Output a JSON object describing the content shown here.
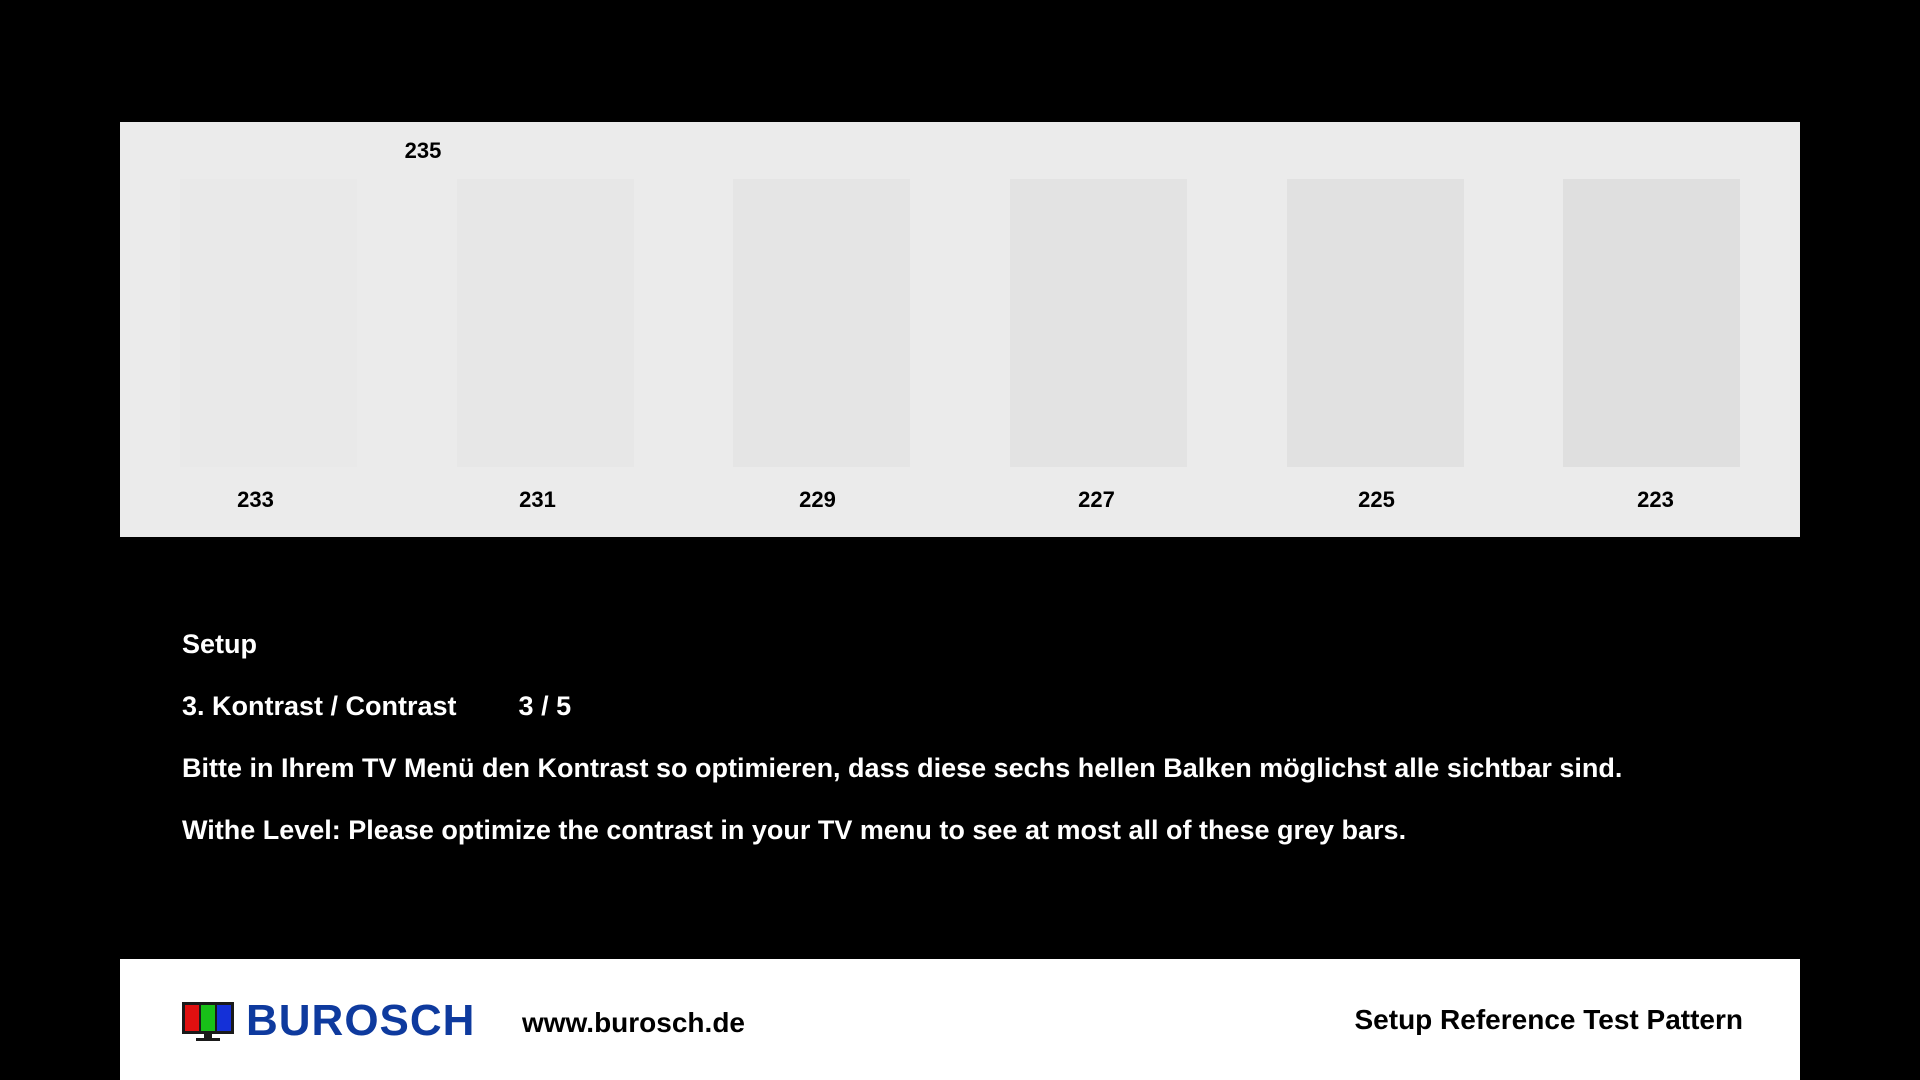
{
  "pattern": {
    "background_level": "235",
    "background_color": "#ebebeb",
    "bars": [
      {
        "label": "233",
        "color": "#e9e9e9"
      },
      {
        "label": "231",
        "color": "#e7e7e7"
      },
      {
        "label": "229",
        "color": "#e5e5e5"
      },
      {
        "label": "227",
        "color": "#e3e3e3"
      },
      {
        "label": "225",
        "color": "#e1e1e1"
      },
      {
        "label": "223",
        "color": "#dfdfdf"
      }
    ]
  },
  "instructions": {
    "heading": "Setup",
    "step_title": "3. Kontrast / Contrast",
    "step_counter": "3 / 5",
    "german_text": "Bitte in Ihrem TV Menü den Kontrast so optimieren, dass diese sechs hellen Balken möglichst alle sichtbar sind.",
    "english_text": "Withe Level: Please optimize the contrast in your TV menu to see at most all of these grey bars."
  },
  "footer": {
    "brand": "BUROSCH",
    "brand_color": "#0e3a9e",
    "logo_icon": "tv-rgb-icon",
    "website": "www.burosch.de",
    "title": "Setup Reference Test Pattern"
  }
}
